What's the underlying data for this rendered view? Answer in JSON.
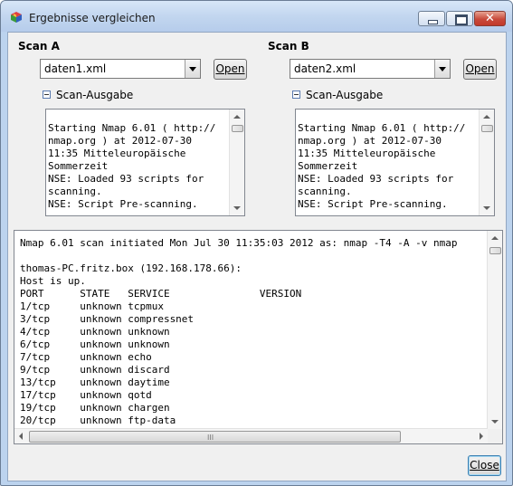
{
  "window": {
    "title": "Ergebnisse vergleichen",
    "icon": "nmap-cube-icon",
    "controls": [
      "minimize",
      "maximize",
      "close"
    ]
  },
  "scan_a": {
    "title": "Scan A",
    "file": "daten1.xml",
    "open_label": "Open",
    "expander_label": "Scan-Ausgabe",
    "output": "Starting Nmap 6.01 ( http://\nnmap.org ) at 2012-07-30\n11:35 Mitteleuropäische\nSommerzeit\nNSE: Loaded 93 scripts for\nscanning.\nNSE: Script Pre-scanning."
  },
  "scan_b": {
    "title": "Scan B",
    "file": "daten2.xml",
    "open_label": "Open",
    "expander_label": "Scan-Ausgabe",
    "output": "Starting Nmap 6.01 ( http://\nnmap.org ) at 2012-07-30\n11:35 Mitteleuropäische\nSommerzeit\nNSE: Loaded 93 scripts for\nscanning.\nNSE: Script Pre-scanning."
  },
  "diff_output": "Nmap 6.01 scan initiated Mon Jul 30 11:35:03 2012 as: nmap -T4 -A -v nmap\n\nthomas-PC.fritz.box (192.168.178.66):\nHost is up.\nPORT      STATE   SERVICE               VERSION\n1/tcp     unknown tcpmux\n3/tcp     unknown compressnet\n4/tcp     unknown unknown\n6/tcp     unknown unknown\n7/tcp     unknown echo\n9/tcp     unknown discard\n13/tcp    unknown daytime\n17/tcp    unknown qotd\n19/tcp    unknown chargen\n20/tcp    unknown ftp-data",
  "footer": {
    "close_label": "Close"
  },
  "colors": {
    "titlebar": "#c2d6ef",
    "close_button": "#c8493a",
    "dialog_bg": "#f0f0f0"
  }
}
